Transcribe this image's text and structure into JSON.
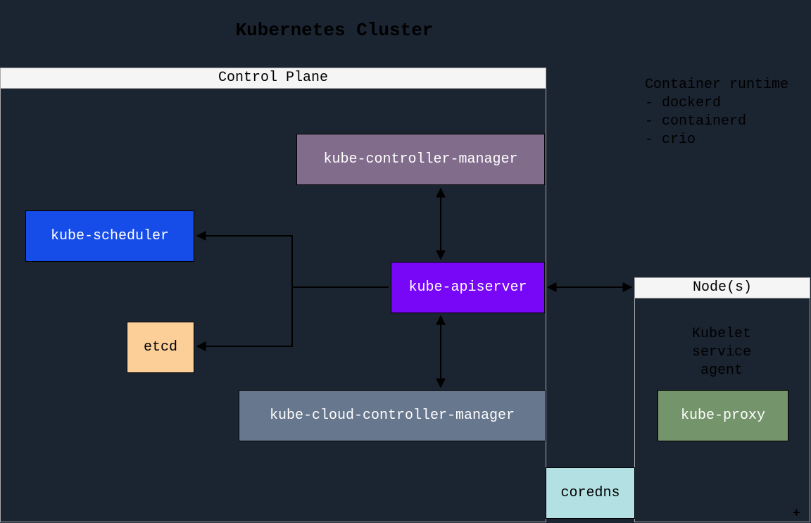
{
  "title": "Kubernetes Cluster",
  "control_plane": {
    "header": "Control Plane",
    "kube_controller_manager": "kube-controller-manager",
    "kube_scheduler": "kube-scheduler",
    "kube_apiserver": "kube-apiserver",
    "etcd": "etcd",
    "kube_cloud_controller_manager": "kube-cloud-controller-manager"
  },
  "node": {
    "header": "Node(s)",
    "kubelet_label": "Kubelet\nservice\nagent",
    "kube_proxy": "kube-proxy",
    "coredns": "coredns"
  },
  "runtime_note": "Container runtime\n- dockerd\n- containerd\n- crio",
  "plus": "+",
  "colors": {
    "kube_controller_manager": "#816c8c",
    "kube_scheduler": "#164ce8",
    "kube_apiserver": "#7806f7",
    "etcd": "#fccf99",
    "kube_cloud_controller_manager": "#67778e",
    "kube_proxy": "#74946b",
    "coredns": "#b3e1e3"
  }
}
